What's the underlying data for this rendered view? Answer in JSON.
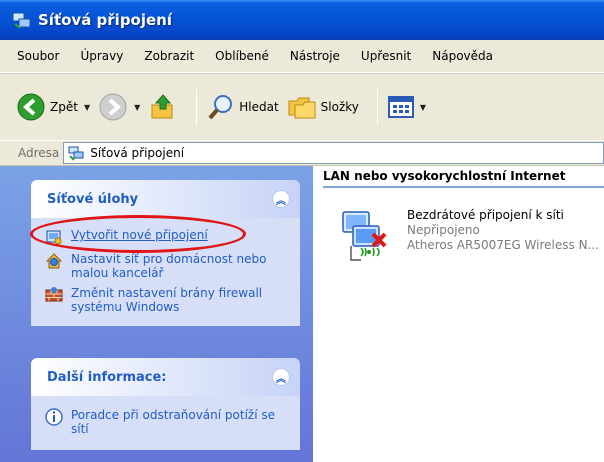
{
  "window": {
    "title": "Síťová připojení"
  },
  "menu": {
    "items": [
      "Soubor",
      "Úpravy",
      "Zobrazit",
      "Oblíbené",
      "Nástroje",
      "Upřesnit",
      "Nápověda"
    ]
  },
  "toolbar": {
    "back_label": "Zpět",
    "search_label": "Hledat",
    "folders_label": "Složky"
  },
  "address": {
    "label": "Adresa",
    "value": "Síťová připojení"
  },
  "tasks_panel": {
    "title": "Síťové úlohy",
    "items": [
      {
        "label": "Vytvořit nové připojení",
        "icon": "new-connection-icon"
      },
      {
        "label": "Nastavit síť pro domácnost nebo malou kancelář",
        "icon": "home-network-icon"
      },
      {
        "label": "Změnit nastavení brány firewall systému Windows",
        "icon": "firewall-icon"
      }
    ]
  },
  "info_panel": {
    "title": "Další informace:",
    "items": [
      {
        "label": "Poradce při odstraňování potíží se sítí",
        "icon": "info-icon"
      }
    ]
  },
  "content": {
    "group_header": "LAN nebo vysokorychlostní Internet",
    "connection": {
      "name": "Bezdrátové připojení k síti",
      "status": "Nepřipojeno",
      "device": "Atheros AR5007EG Wireless N..."
    }
  },
  "colors": {
    "title_bar": "#0553d6",
    "panel_bg": "#d6dff7",
    "link": "#215dc6",
    "highlight": "#e01515"
  }
}
